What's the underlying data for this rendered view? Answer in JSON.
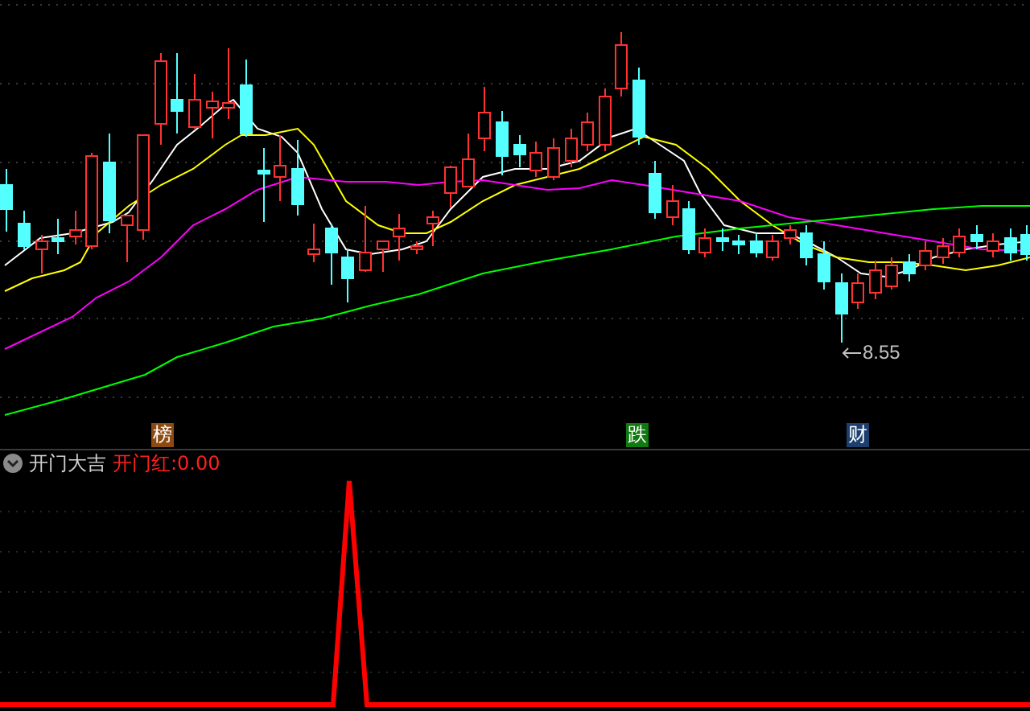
{
  "main_chart": {
    "markers": [
      {
        "label": "榜",
        "color": "#8a4a12"
      },
      {
        "label": "跌",
        "color": "#107a10"
      },
      {
        "label": "财",
        "color": "#1c3f6e"
      }
    ],
    "low_label": "8.55"
  },
  "indicator": {
    "title": "开门大吉",
    "value": "开门红:0.00"
  }
}
